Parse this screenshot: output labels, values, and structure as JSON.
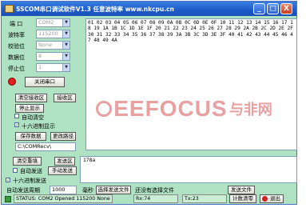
{
  "window": {
    "title": "SSCOM串口调试软件V1.3  任意波特率       www.nkcpu.cn"
  },
  "titlebar_buttons": {
    "minimize": "_",
    "maximize": "□",
    "close": "X"
  },
  "settings": {
    "port_label": "端 口",
    "port_value": "COM2",
    "baud_label": "波特率",
    "baud_value": "115200",
    "parity_label": "校验位",
    "parity_value": "None",
    "databits_label": "数据位",
    "databits_value": "8",
    "stopbits_label": "停止位",
    "stopbits_value": "1"
  },
  "port_button": "关闭串口",
  "left_buttons": {
    "clear_receive": "清空接收区",
    "receive_area": "接收区",
    "stop_display": "停止显示",
    "save_data": "保存数据",
    "change_path": "更改路径"
  },
  "left_checks": {
    "auto_clear": "自动清空",
    "hex_display": "十六进制显示"
  },
  "save_path": "C:\\COMRecv\\",
  "receive_text": "01 02 03 04 05 06 07 08 09 0A 0B 0C 0D 0E 0F 10 11 12 13 14 15 16 17 18 19 1A 1B 1C 1D 1E 1F 20 21 22 23 24 25 26 27 28 29 2A 2B 2C 2D 2E 2F 30 31 32 33 34 35 36 37 38 39 3A 3B 3C 3D 3E 3F 40 41 42 43 44 45 46 47 48 49 4A",
  "send": {
    "clear_send": "清空重填",
    "send_area": "发送区",
    "auto_send": "自动发送",
    "manual_send": "手动发送",
    "hex_send": "十六进制发送",
    "period_label": "自动发送周期",
    "period_value": "1000",
    "ms": "毫秒",
    "choose_file": "选择发送文件",
    "no_file": "还没有选择文件",
    "send_file": "发送文件",
    "send_text": "178a"
  },
  "status": {
    "status_text": "STATUS: COM2 Opened 115200 None 8 1",
    "rx": "Rx:74",
    "tx": "Tx:23",
    "clear_count": "计数清零",
    "exit": "退出"
  },
  "watermark": {
    "brand": "EEFOCUS",
    "cn": "与非网"
  },
  "colors": {
    "title_bar": "#1c5ac8",
    "window_bg": "#aee2c2",
    "indicator_red": "#e02020",
    "watermark_red": "#e8a0a0"
  }
}
